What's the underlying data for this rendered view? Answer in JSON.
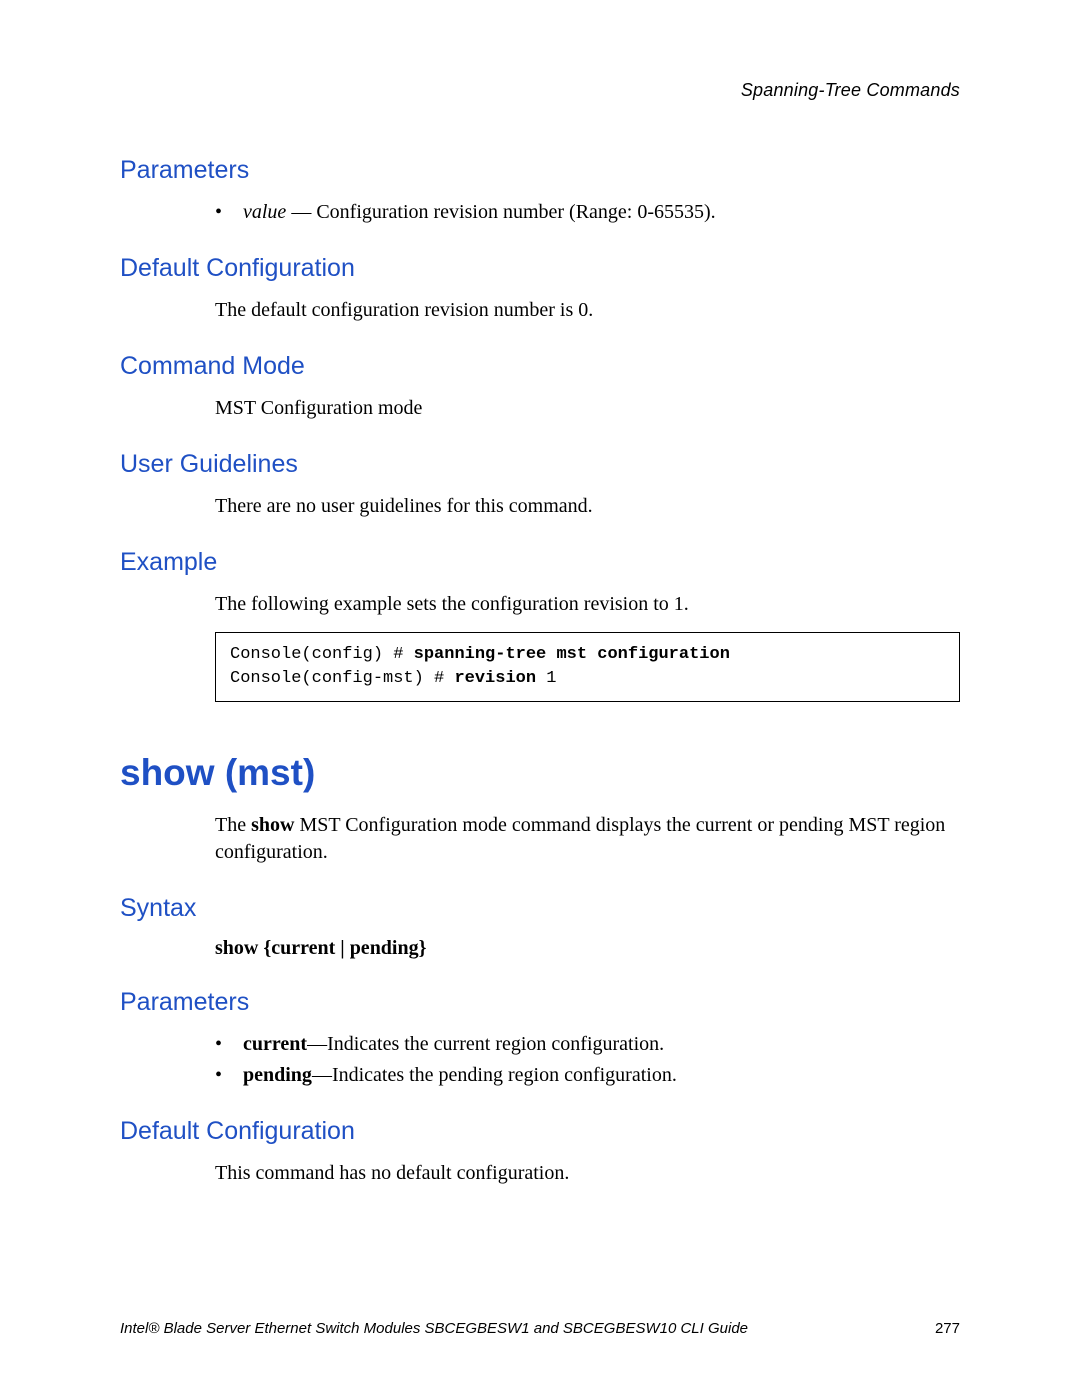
{
  "header": {
    "title": "Spanning-Tree Commands"
  },
  "sections": {
    "parameters1": {
      "heading": "Parameters",
      "bullet_param": "value",
      "bullet_text": " — Configuration revision number (Range: 0-65535)."
    },
    "default1": {
      "heading": "Default Configuration",
      "body": "The default configuration revision number is 0."
    },
    "cmdmode": {
      "heading": "Command Mode",
      "body": "MST Configuration mode"
    },
    "userguide": {
      "heading": "User Guidelines",
      "body": "There are no user guidelines for this command."
    },
    "example": {
      "heading": "Example",
      "body": "The following example sets the configuration revision to 1.",
      "code_line1_pre": "Console(config) # ",
      "code_line1_cmd": "spanning-tree mst configuration",
      "code_line2_pre": "Console(config-mst) # ",
      "code_line2_cmd": "revision ",
      "code_line2_arg": "1"
    },
    "showmst": {
      "title": "show (mst)",
      "intro_pre": "The ",
      "intro_strong": "show",
      "intro_post": " MST Configuration mode command displays the current or pending MST region configuration."
    },
    "syntax": {
      "heading": "Syntax",
      "line": "show {current | pending}"
    },
    "parameters2": {
      "heading": "Parameters",
      "b1_strong": "current",
      "b1_post": "—Indicates the current region configuration.",
      "b2_strong": "pending",
      "b2_post": "—Indicates the pending region configuration."
    },
    "default2": {
      "heading": "Default Configuration",
      "body": "This command has no default configuration."
    }
  },
  "footer": {
    "text": "Intel® Blade Server Ethernet Switch Modules SBCEGBESW1 and SBCEGBESW10 CLI Guide",
    "page": "277"
  }
}
